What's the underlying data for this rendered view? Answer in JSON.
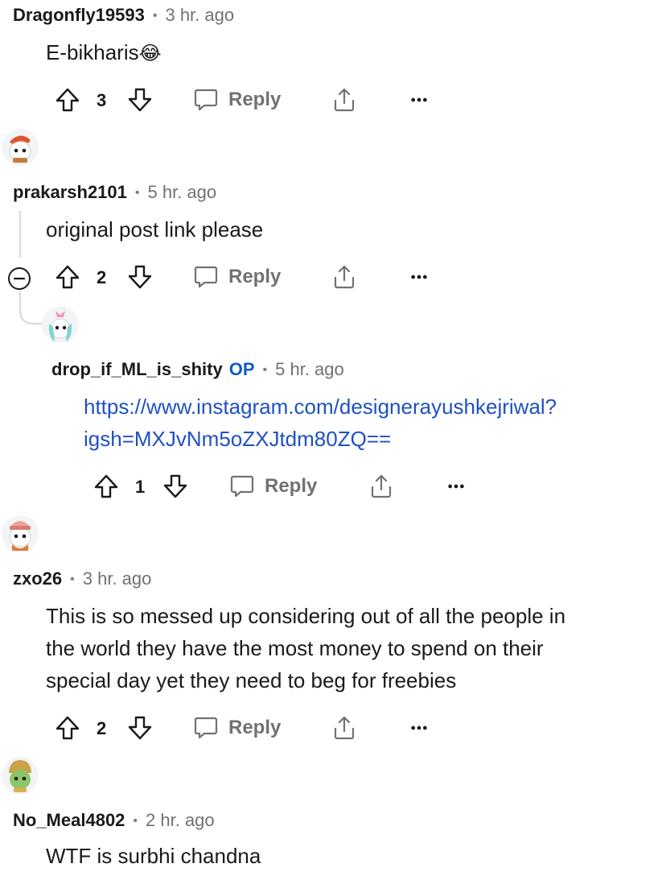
{
  "comments": [
    {
      "user": "Dragonfly19593",
      "time": "3 hr. ago",
      "body": "E-bikharis",
      "emoji": "😂",
      "votes": "3",
      "reply_label": "Reply"
    },
    {
      "user": "prakarsh2101",
      "time": "5 hr. ago",
      "body": "original post link please",
      "votes": "2",
      "reply_label": "Reply"
    },
    {
      "user": "drop_if_ML_is_shity",
      "op_badge": "OP",
      "time": "5 hr. ago",
      "link_line1": "https://www.instagram.com/designerayushkejriwal?",
      "link_line2": "igsh=MXJvNm5oZXJtdm80ZQ==",
      "votes": "1",
      "reply_label": "Reply"
    },
    {
      "user": "zxo26",
      "time": "3 hr. ago",
      "body_line1": "This is so messed up considering out of all the people in",
      "body_line2": "the world they have the most money to spend on their",
      "body_line3": "special day yet they need to beg for freebies",
      "votes": "2",
      "reply_label": "Reply"
    },
    {
      "user": "No_Meal4802",
      "time": "2 hr. ago",
      "body": "WTF is surbhi chandna"
    }
  ],
  "separator": "•",
  "icons": {
    "upvote": "upvote-arrow-icon",
    "downvote": "downvote-arrow-icon",
    "reply": "reply-bubble-icon",
    "share": "share-icon",
    "more": "more-options-icon",
    "collapse": "collapse-minus-icon"
  },
  "colors": {
    "link": "#1f51c2",
    "op": "#0f5fbf",
    "meta": "#6f7275"
  }
}
